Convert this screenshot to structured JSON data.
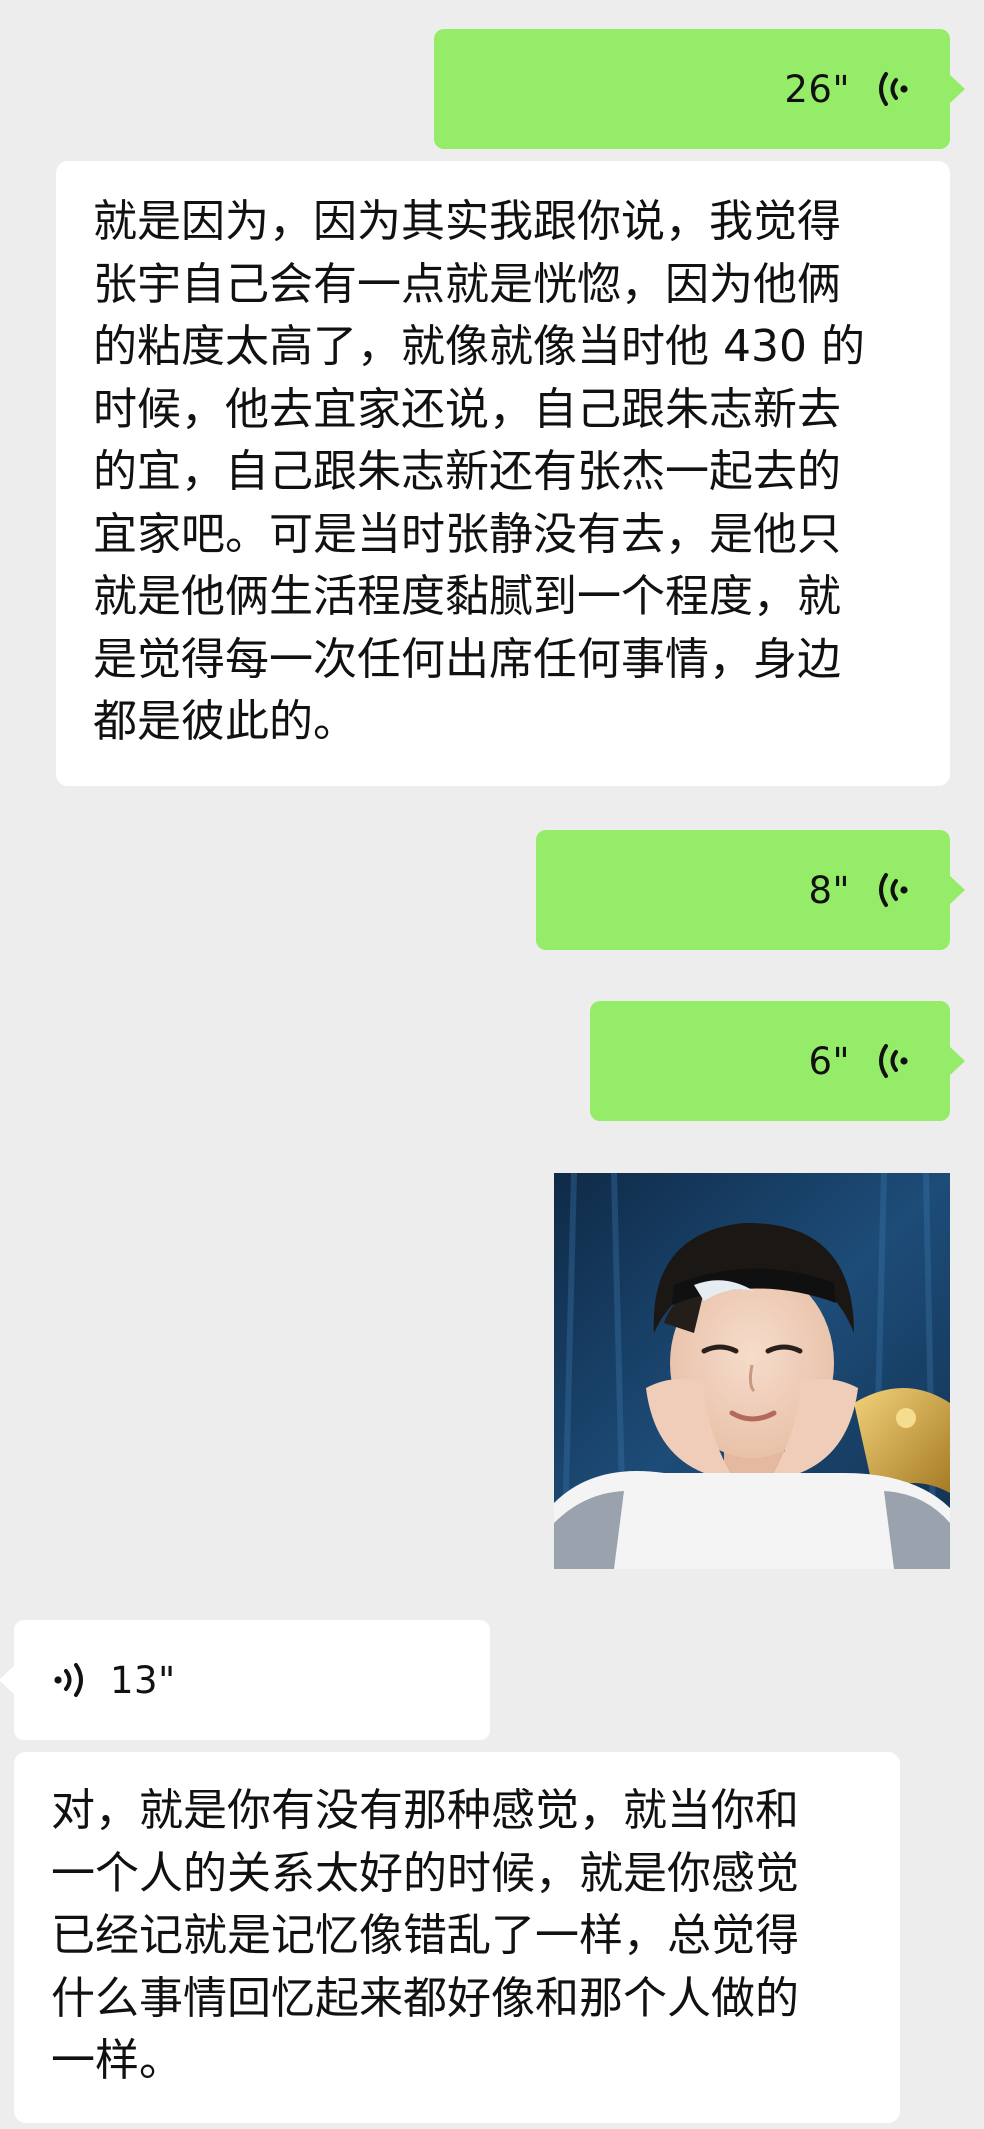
{
  "conversation": {
    "messages": [
      {
        "kind": "voice",
        "direction": "outgoing",
        "duration": "26\""
      },
      {
        "kind": "text",
        "direction": "incoming",
        "text": "就是因为，因为其实我跟你说，我觉得\n张宇自己会有一点就是恍惚，因为他俩\n的粘度太高了，就像就像当时他 430 的\n时候，他去宜家还说，自己跟朱志新去\n的宜，自己跟朱志新还有张杰一起去的\n宜家吧。可是当时张静没有去，是他只\n就是他俩生活程度黏腻到一个程度，就\n是觉得每一次任何出席任何事情，身边\n都是彼此的。"
      },
      {
        "kind": "voice",
        "direction": "outgoing",
        "duration": "8\""
      },
      {
        "kind": "voice",
        "direction": "outgoing",
        "duration": "6\""
      },
      {
        "kind": "image",
        "direction": "outgoing"
      },
      {
        "kind": "voice",
        "direction": "incoming",
        "duration": "13\""
      },
      {
        "kind": "text",
        "direction": "incoming",
        "text": "对，就是你有没有那种感觉，就当你和\n一个人的关系太好的时候，就是你感觉\n已经记就是记忆像错乱了一样，总觉得\n什么事情回忆起来都好像和那个人做的\n一样。"
      }
    ]
  },
  "icons": {
    "voice_outgoing": "voice-wave-outgoing-icon",
    "voice_incoming": "voice-wave-incoming-icon"
  },
  "colors": {
    "background": "#ededed",
    "outgoing_bubble": "#95ec69",
    "incoming_bubble": "#ffffff",
    "text": "#111111"
  }
}
